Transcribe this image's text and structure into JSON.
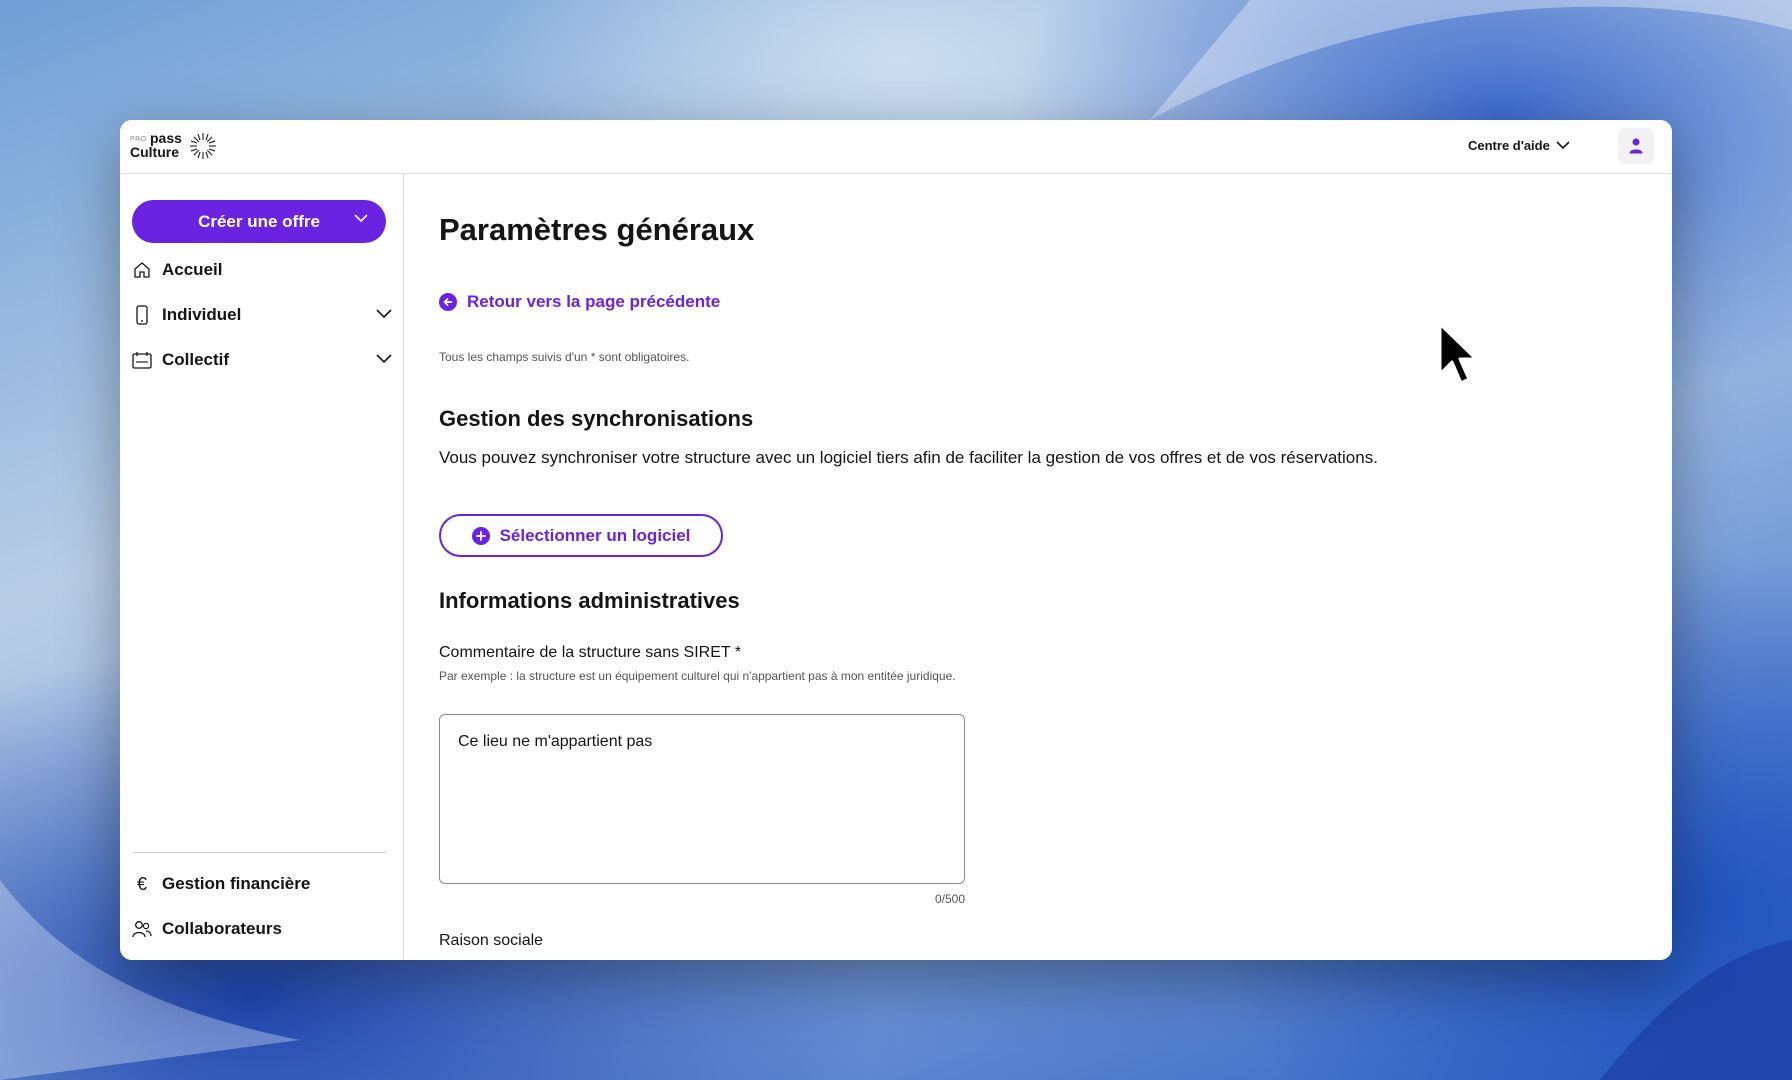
{
  "header": {
    "logo_pro": "PRO",
    "logo_pass": "pass",
    "logo_culture": "Culture",
    "help_label": "Centre d'aide",
    "user_icon": "user-icon"
  },
  "sidebar": {
    "create_offer_label": "Créer une offre",
    "items": [
      {
        "label": "Accueil",
        "icon": "home-icon"
      },
      {
        "label": "Individuel",
        "icon": "phone-icon"
      },
      {
        "label": "Collectif",
        "icon": "calendar-icon"
      }
    ],
    "bottom_items": [
      {
        "label": "Gestion financière",
        "icon": "euro-icon"
      },
      {
        "label": "Collaborateurs",
        "icon": "users-icon"
      }
    ]
  },
  "main": {
    "title": "Paramètres généraux",
    "back_link": "Retour vers la page précédente",
    "mandatory_note": "Tous les champs suivis d'un * sont obligatoires.",
    "sync_section": {
      "title": "Gestion des synchronisations",
      "description": "Vous pouvez synchroniser votre structure avec un logiciel tiers afin de faciliter la gestion de vos offres et de vos réservations.",
      "button_label": "Sélectionner un logiciel"
    },
    "admin_section": {
      "title": "Informations administratives",
      "comment_label": "Commentaire de la structure sans SIRET *",
      "comment_hint": "Par exemple : la structure est un équipement culturel qui n'appartient pas à mon entitée juridique.",
      "comment_value": "Ce lieu ne m'appartient pas",
      "comment_counter": "0/500",
      "raison_sociale_label": "Raison sociale"
    }
  },
  "colors": {
    "accent": "#6a23e0",
    "text": "#151515"
  }
}
